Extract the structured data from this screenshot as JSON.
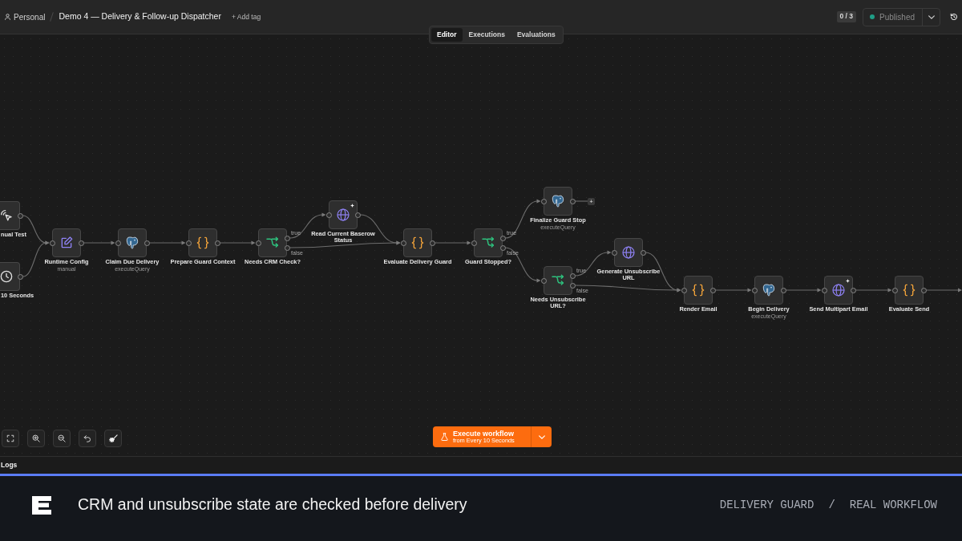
{
  "header": {
    "owner": "Personal",
    "title": "Demo 4 — Delivery & Follow-up Dispatcher",
    "add_tag": "+ Add tag",
    "counter": "0 / 3",
    "status": "Published"
  },
  "tabs": [
    {
      "label": "Editor",
      "selected": true
    },
    {
      "label": "Executions",
      "selected": false
    },
    {
      "label": "Evaluations",
      "selected": false
    }
  ],
  "canvas": {
    "nodes": [
      {
        "kind": "manual",
        "label": "nual Test",
        "sparkle": false
      },
      {
        "kind": "schedule",
        "label": "10 Seconds",
        "sparkle": false
      },
      {
        "kind": "edit",
        "label": "Runtime Config",
        "subtitle": "manual",
        "sparkle": false
      },
      {
        "kind": "postgres",
        "label": "Claim Due Delivery",
        "subtitle": "executeQuery",
        "sparkle": false
      },
      {
        "kind": "code",
        "label": "Prepare Guard Context",
        "sparkle": false
      },
      {
        "kind": "if",
        "label": "Needs CRM Check?",
        "outputs": [
          "true",
          "false"
        ],
        "sparkle": false
      },
      {
        "kind": "http",
        "label": "Read Current Baserow Status",
        "sparkle": true
      },
      {
        "kind": "code",
        "label": "Evaluate Delivery Guard",
        "sparkle": false
      },
      {
        "kind": "if",
        "label": "Guard Stopped?",
        "outputs": [
          "true",
          "false"
        ],
        "sparkle": false
      },
      {
        "kind": "postgres",
        "label": "Finalize Guard Stop",
        "subtitle": "executeQuery",
        "add_button": "+",
        "sparkle": false
      },
      {
        "kind": "if",
        "label": "Needs Unsubscribe URL?",
        "outputs": [
          "true",
          "false"
        ],
        "sparkle": false
      },
      {
        "kind": "http",
        "label": "Generate Unsubscribe URL",
        "sparkle": false
      },
      {
        "kind": "code",
        "label": "Render Email",
        "sparkle": false
      },
      {
        "kind": "postgres",
        "label": "Begin Delivery",
        "subtitle": "executeQuery",
        "sparkle": false
      },
      {
        "kind": "http",
        "label": "Send Multipart Email",
        "sparkle": true
      },
      {
        "kind": "code",
        "label": "Evaluate Send",
        "sparkle": false
      }
    ]
  },
  "execute": {
    "label": "Execute workflow",
    "source": "from Every 10 Seconds"
  },
  "logs": {
    "title": "Logs"
  },
  "footer": {
    "headline": "CRM and unsubscribe state are checked before delivery",
    "tags": [
      "DELIVERY GUARD",
      "REAL WORKFLOW"
    ],
    "separator": "/"
  }
}
